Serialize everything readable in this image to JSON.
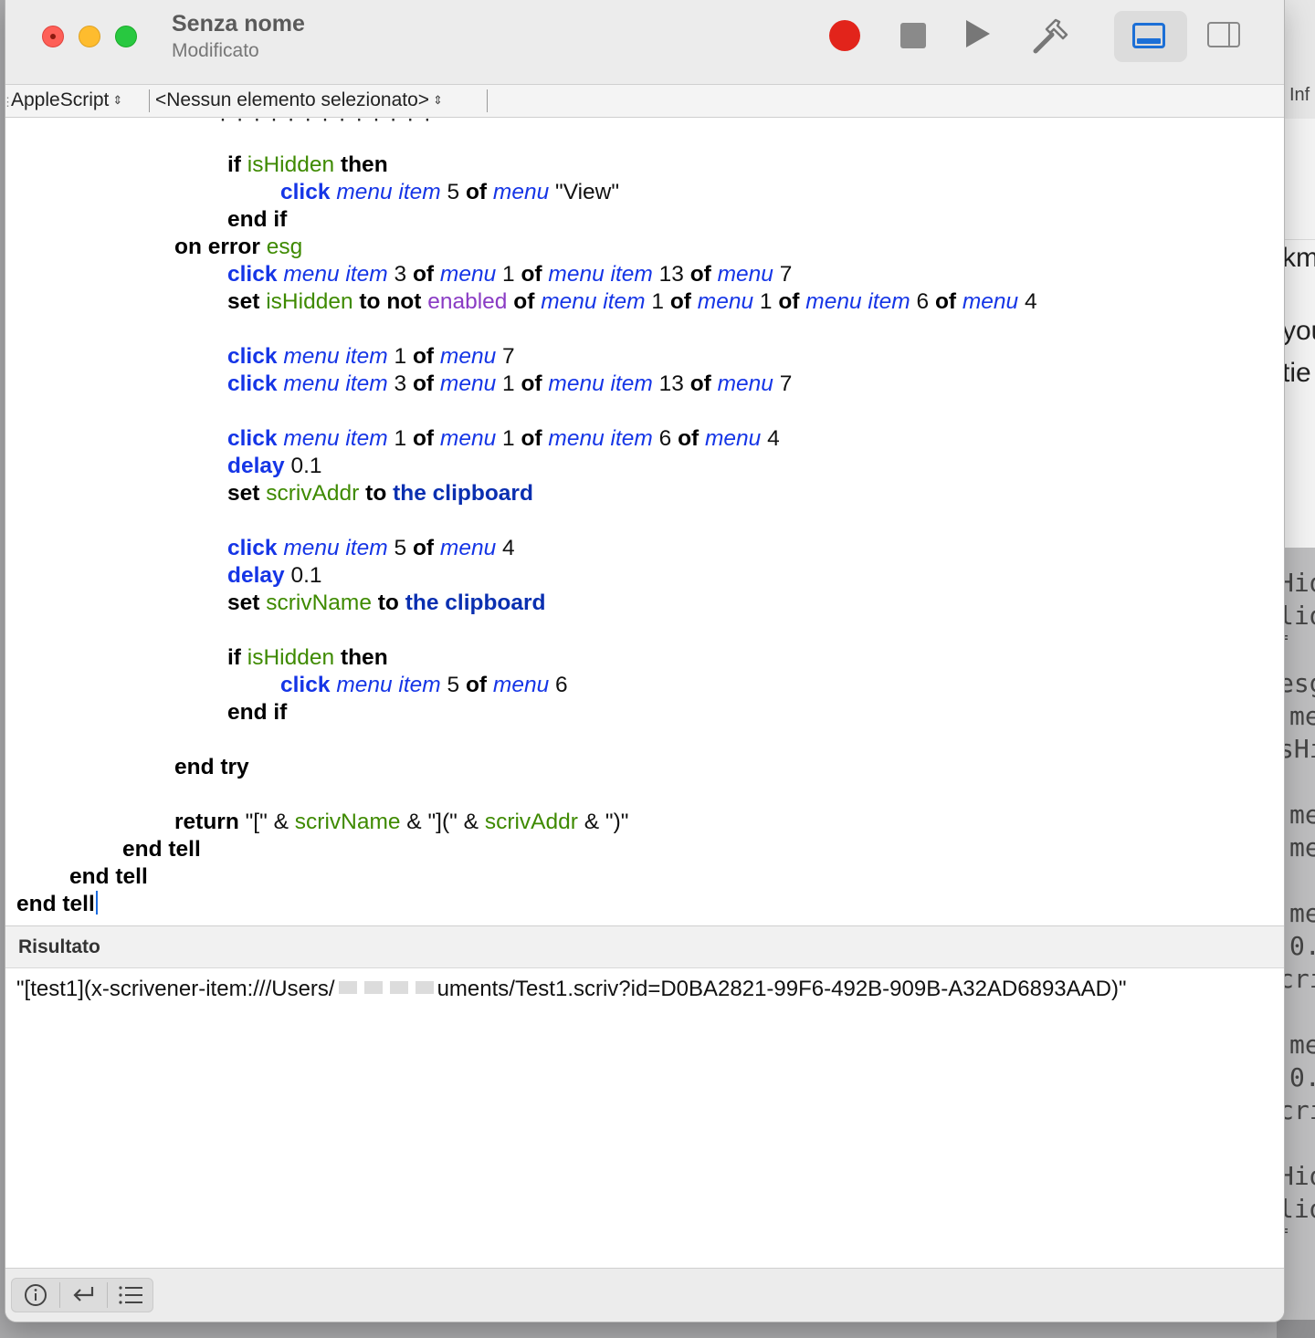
{
  "window": {
    "title": "Senza nome",
    "subtitle": "Modificato"
  },
  "toolbar": {
    "icons": [
      "record-icon",
      "stop-icon",
      "run-icon",
      "compile-hammer-icon",
      "bottom-pane-icon",
      "side-pane-icon"
    ],
    "colors": {
      "record": "#e2241b",
      "active_toggle": "#1c6fd6"
    }
  },
  "navbar": {
    "language": "AppleScript",
    "element": "<Nessun elemento selezionato>"
  },
  "code": [
    [
      [
        "kw",
        "if"
      ],
      [
        "t",
        " "
      ],
      [
        "var",
        "isHidden"
      ],
      [
        "t",
        " "
      ],
      [
        "kw",
        "then"
      ]
    ],
    [
      [
        "cmd",
        "click"
      ],
      [
        "t",
        " "
      ],
      [
        "cls",
        "menu item"
      ],
      [
        "t",
        " "
      ],
      [
        "num",
        "5"
      ],
      [
        "t",
        " "
      ],
      [
        "kw",
        "of"
      ],
      [
        "t",
        " "
      ],
      [
        "cls",
        "menu"
      ],
      [
        "t",
        " "
      ],
      [
        "str",
        "\"View\""
      ]
    ],
    [
      [
        "kw",
        "end if"
      ]
    ],
    [
      [
        "kw",
        "on error"
      ],
      [
        "t",
        " "
      ],
      [
        "var",
        "esg"
      ]
    ],
    [
      [
        "cmd",
        "click"
      ],
      [
        "t",
        " "
      ],
      [
        "cls",
        "menu item"
      ],
      [
        "t",
        " "
      ],
      [
        "num",
        "3"
      ],
      [
        "t",
        " "
      ],
      [
        "kw",
        "of"
      ],
      [
        "t",
        " "
      ],
      [
        "cls",
        "menu"
      ],
      [
        "t",
        " "
      ],
      [
        "num",
        "1"
      ],
      [
        "t",
        " "
      ],
      [
        "kw",
        "of"
      ],
      [
        "t",
        " "
      ],
      [
        "cls",
        "menu item"
      ],
      [
        "t",
        " "
      ],
      [
        "num",
        "13"
      ],
      [
        "t",
        " "
      ],
      [
        "kw",
        "of"
      ],
      [
        "t",
        " "
      ],
      [
        "cls",
        "menu"
      ],
      [
        "t",
        " "
      ],
      [
        "num",
        "7"
      ]
    ],
    [
      [
        "kw",
        "set"
      ],
      [
        "t",
        " "
      ],
      [
        "var",
        "isHidden"
      ],
      [
        "t",
        " "
      ],
      [
        "kw",
        "to not"
      ],
      [
        "t",
        " "
      ],
      [
        "prop",
        "enabled"
      ],
      [
        "t",
        " "
      ],
      [
        "kw",
        "of"
      ],
      [
        "t",
        " "
      ],
      [
        "cls",
        "menu item"
      ],
      [
        "t",
        " "
      ],
      [
        "num",
        "1"
      ],
      [
        "t",
        " "
      ],
      [
        "kw",
        "of"
      ],
      [
        "t",
        " "
      ],
      [
        "cls",
        "menu"
      ],
      [
        "t",
        " "
      ],
      [
        "num",
        "1"
      ],
      [
        "t",
        " "
      ],
      [
        "kw",
        "of"
      ],
      [
        "t",
        " "
      ],
      [
        "cls",
        "menu item"
      ],
      [
        "t",
        " "
      ],
      [
        "num",
        "6"
      ],
      [
        "t",
        " "
      ],
      [
        "kw",
        "of"
      ],
      [
        "t",
        " "
      ],
      [
        "cls",
        "menu"
      ],
      [
        "t",
        " "
      ],
      [
        "num",
        "4"
      ]
    ],
    [
      [
        "cmd",
        "click"
      ],
      [
        "t",
        " "
      ],
      [
        "cls",
        "menu item"
      ],
      [
        "t",
        " "
      ],
      [
        "num",
        "1"
      ],
      [
        "t",
        " "
      ],
      [
        "kw",
        "of"
      ],
      [
        "t",
        " "
      ],
      [
        "cls",
        "menu"
      ],
      [
        "t",
        " "
      ],
      [
        "num",
        "7"
      ]
    ],
    [
      [
        "cmd",
        "click"
      ],
      [
        "t",
        " "
      ],
      [
        "cls",
        "menu item"
      ],
      [
        "t",
        " "
      ],
      [
        "num",
        "3"
      ],
      [
        "t",
        " "
      ],
      [
        "kw",
        "of"
      ],
      [
        "t",
        " "
      ],
      [
        "cls",
        "menu"
      ],
      [
        "t",
        " "
      ],
      [
        "num",
        "1"
      ],
      [
        "t",
        " "
      ],
      [
        "kw",
        "of"
      ],
      [
        "t",
        " "
      ],
      [
        "cls",
        "menu item"
      ],
      [
        "t",
        " "
      ],
      [
        "num",
        "13"
      ],
      [
        "t",
        " "
      ],
      [
        "kw",
        "of"
      ],
      [
        "t",
        " "
      ],
      [
        "cls",
        "menu"
      ],
      [
        "t",
        " "
      ],
      [
        "num",
        "7"
      ]
    ],
    [
      [
        "cmd",
        "click"
      ],
      [
        "t",
        " "
      ],
      [
        "cls",
        "menu item"
      ],
      [
        "t",
        " "
      ],
      [
        "num",
        "1"
      ],
      [
        "t",
        " "
      ],
      [
        "kw",
        "of"
      ],
      [
        "t",
        " "
      ],
      [
        "cls",
        "menu"
      ],
      [
        "t",
        " "
      ],
      [
        "num",
        "1"
      ],
      [
        "t",
        " "
      ],
      [
        "kw",
        "of"
      ],
      [
        "t",
        " "
      ],
      [
        "cls",
        "menu item"
      ],
      [
        "t",
        " "
      ],
      [
        "num",
        "6"
      ],
      [
        "t",
        " "
      ],
      [
        "kw",
        "of"
      ],
      [
        "t",
        " "
      ],
      [
        "cls",
        "menu"
      ],
      [
        "t",
        " "
      ],
      [
        "num",
        "4"
      ]
    ],
    [
      [
        "cmd",
        "delay"
      ],
      [
        "t",
        " "
      ],
      [
        "num",
        "0.1"
      ]
    ],
    [
      [
        "kw",
        "set"
      ],
      [
        "t",
        " "
      ],
      [
        "var",
        "scrivAddr"
      ],
      [
        "t",
        " "
      ],
      [
        "kw",
        "to"
      ],
      [
        "t",
        " "
      ],
      [
        "const",
        "the clipboard"
      ]
    ],
    [
      [
        "cmd",
        "click"
      ],
      [
        "t",
        " "
      ],
      [
        "cls",
        "menu item"
      ],
      [
        "t",
        " "
      ],
      [
        "num",
        "5"
      ],
      [
        "t",
        " "
      ],
      [
        "kw",
        "of"
      ],
      [
        "t",
        " "
      ],
      [
        "cls",
        "menu"
      ],
      [
        "t",
        " "
      ],
      [
        "num",
        "4"
      ]
    ],
    [
      [
        "cmd",
        "delay"
      ],
      [
        "t",
        " "
      ],
      [
        "num",
        "0.1"
      ]
    ],
    [
      [
        "kw",
        "set"
      ],
      [
        "t",
        " "
      ],
      [
        "var",
        "scrivName"
      ],
      [
        "t",
        " "
      ],
      [
        "kw",
        "to"
      ],
      [
        "t",
        " "
      ],
      [
        "const",
        "the clipboard"
      ]
    ],
    [
      [
        "kw",
        "if"
      ],
      [
        "t",
        " "
      ],
      [
        "var",
        "isHidden"
      ],
      [
        "t",
        " "
      ],
      [
        "kw",
        "then"
      ]
    ],
    [
      [
        "cmd",
        "click"
      ],
      [
        "t",
        " "
      ],
      [
        "cls",
        "menu item"
      ],
      [
        "t",
        " "
      ],
      [
        "num",
        "5"
      ],
      [
        "t",
        " "
      ],
      [
        "kw",
        "of"
      ],
      [
        "t",
        " "
      ],
      [
        "cls",
        "menu"
      ],
      [
        "t",
        " "
      ],
      [
        "num",
        "6"
      ]
    ],
    [
      [
        "kw",
        "end if"
      ]
    ],
    [
      [
        "kw",
        "end try"
      ]
    ],
    [
      [
        "kw",
        "return"
      ],
      [
        "t",
        " "
      ],
      [
        "str",
        "\"[\""
      ],
      [
        "t",
        " & "
      ],
      [
        "var",
        "scrivName"
      ],
      [
        "t",
        " & "
      ],
      [
        "str",
        "\"](\""
      ],
      [
        "t",
        " & "
      ],
      [
        "var",
        "scrivAddr"
      ],
      [
        "t",
        " & "
      ],
      [
        "str",
        "\")\""
      ]
    ],
    [
      [
        "kw",
        "end tell"
      ]
    ],
    [
      [
        "kw",
        "end tell"
      ]
    ],
    [
      [
        "kw",
        "end tell"
      ]
    ]
  ],
  "result": {
    "title": "Risultato",
    "text_start": "\"[test1](x-scrivener-item:///Users/",
    "text_end": "uments/Test1.scriv?id=D0BA2821-99F6-492B-909B-A32AD6893AAD)\""
  },
  "bottom_bar": {
    "icons": [
      "info-icon",
      "return-arrow-icon",
      "list-icon"
    ]
  },
  "background_window": {
    "label": "Inf",
    "fragments": [
      "km",
      "you",
      "tie"
    ],
    "code_fragments": [
      "Hid",
      "lid",
      "=",
      "esg",
      "me",
      "sHi",
      "me",
      "me",
      "me",
      "0.",
      "cri",
      "me",
      "0.",
      "cri",
      "Hid",
      "lid",
      "="
    ]
  }
}
